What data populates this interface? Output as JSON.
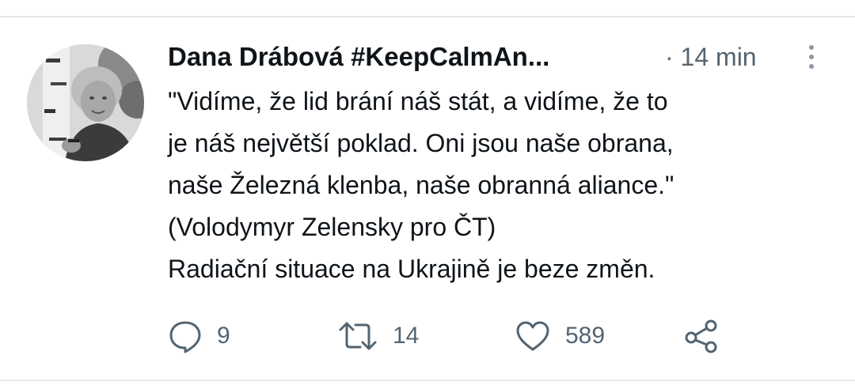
{
  "tweet": {
    "author": "Dana Drábová #KeepCalmAn...",
    "separator": "·",
    "time": "14 min",
    "lines": [
      "\"Vidíme, že lid brání náš stát, a vidíme, že to",
      "je náš největší poklad. Oni jsou naše obrana,",
      "naše Železná klenba, naše obranná aliance.\"",
      "(Volodymyr Zelensky pro ČT)",
      "Radiační situace na Ukrajině je beze změn."
    ]
  },
  "actions": {
    "replies": "9",
    "retweets": "14",
    "likes": "589"
  },
  "icons": {
    "reply": "comment-bubble-icon",
    "retweet": "retweet-icon",
    "like": "heart-icon",
    "share": "share-icon",
    "more": "more-vertical-icon"
  },
  "colors": {
    "text": "#0f1419",
    "secondary": "#536471",
    "divider": "#e6e9ec"
  }
}
